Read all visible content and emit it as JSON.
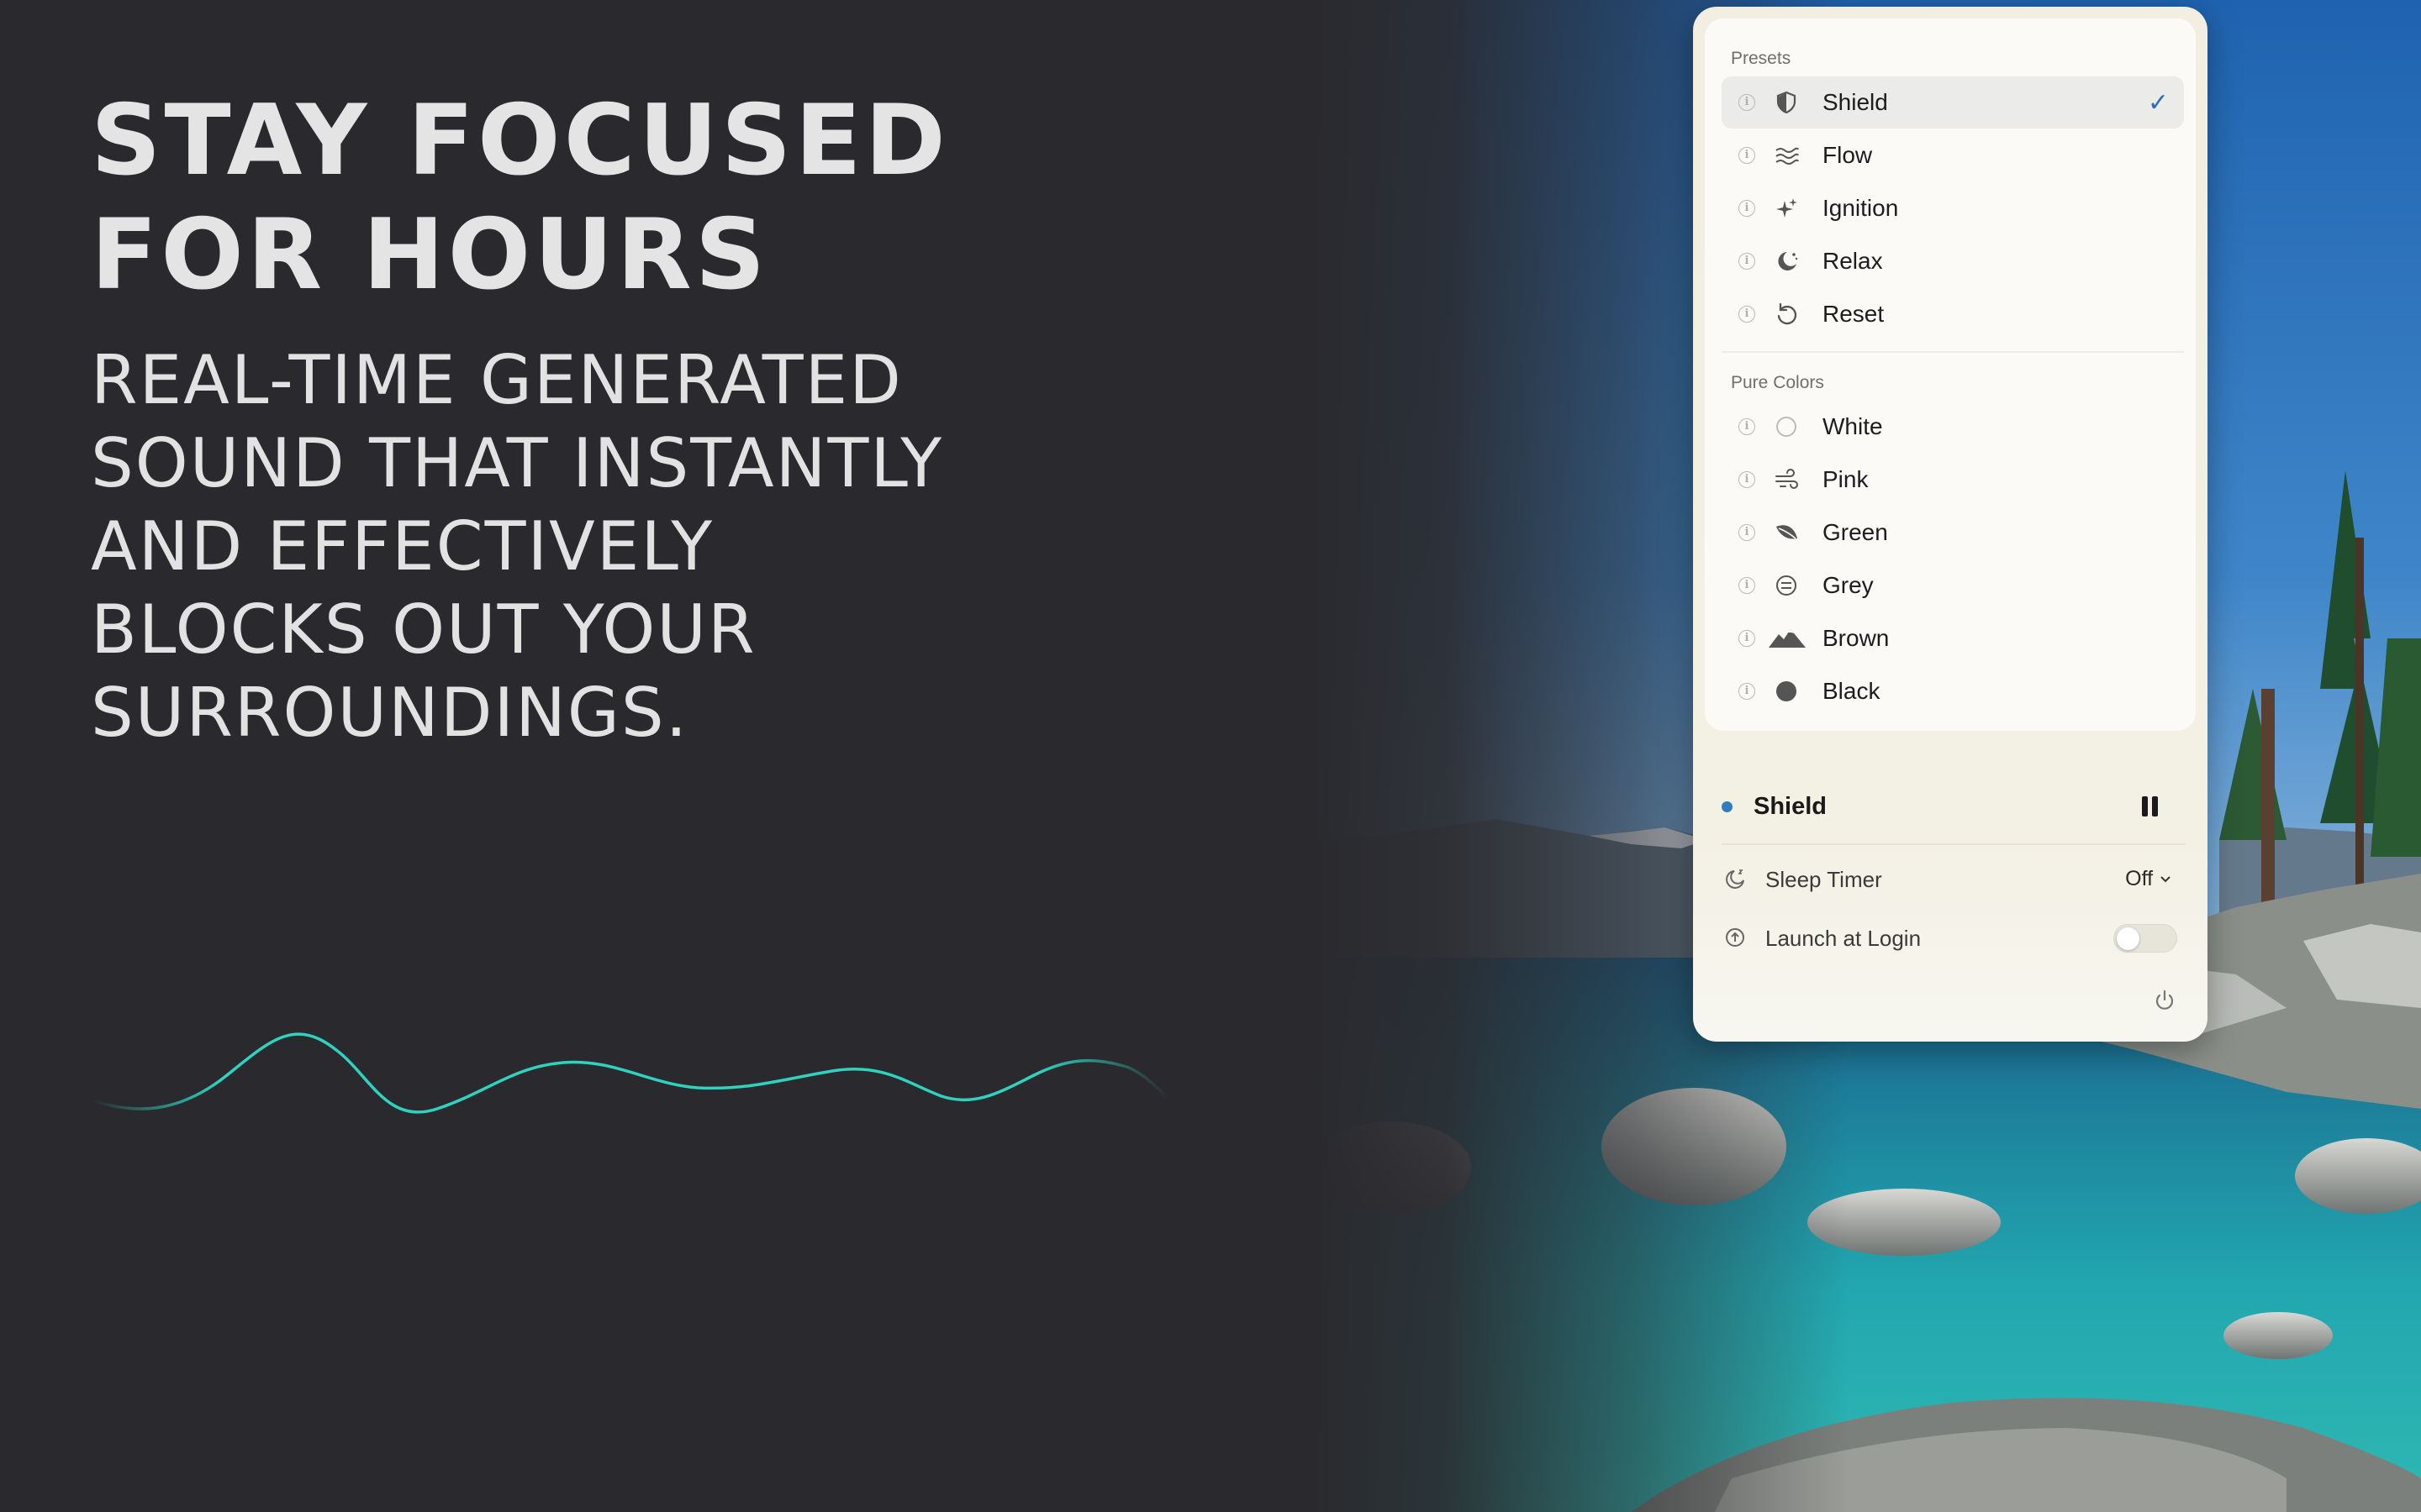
{
  "hero": {
    "headline_lines": [
      "STAY FOCUSED",
      "FOR HOURS"
    ],
    "subline_lines": [
      "REAL-TIME GENERATED",
      "SOUND THAT INSTANTLY",
      "AND EFFECTIVELY",
      "BLOCKS OUT YOUR",
      "SURROUNDINGS."
    ]
  },
  "menu": {
    "presets_title": "Presets",
    "presets": [
      {
        "label": "Shield",
        "icon": "shield-icon",
        "selected": true
      },
      {
        "label": "Flow",
        "icon": "waves-icon",
        "selected": false
      },
      {
        "label": "Ignition",
        "icon": "sparkles-icon",
        "selected": false
      },
      {
        "label": "Relax",
        "icon": "moon-stars-icon",
        "selected": false
      },
      {
        "label": "Reset",
        "icon": "reset-arrow-icon",
        "selected": false
      }
    ],
    "pure_colors_title": "Pure Colors",
    "pure_colors": [
      {
        "label": "White",
        "icon": "circle-outline-icon"
      },
      {
        "label": "Pink",
        "icon": "wind-icon"
      },
      {
        "label": "Green",
        "icon": "leaf-icon"
      },
      {
        "label": "Grey",
        "icon": "grey-circle-icon"
      },
      {
        "label": "Brown",
        "icon": "mountains-icon"
      },
      {
        "label": "Black",
        "icon": "filled-circle-icon"
      }
    ],
    "checkmark": "✓",
    "info_glyph": "i"
  },
  "now_playing": {
    "label": "Shield",
    "status": "playing"
  },
  "settings": {
    "sleep_timer_label": "Sleep Timer",
    "sleep_timer_value": "Off",
    "launch_at_login_label": "Launch at Login",
    "launch_at_login_on": false
  },
  "colors": {
    "accent_blue": "#2f7dbe",
    "wave_teal": "#2ed3c0",
    "background_dark": "#2a2a2e",
    "panel_cream": "#f2efe2"
  }
}
